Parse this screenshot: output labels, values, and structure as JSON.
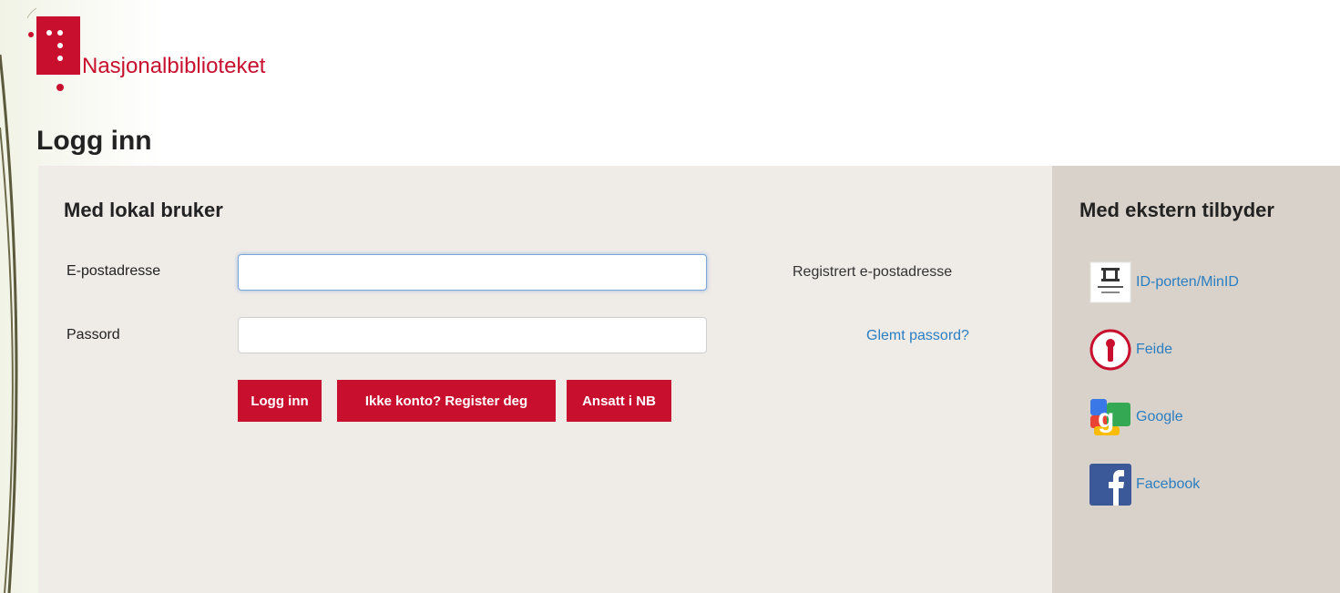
{
  "brand": {
    "name": "Nasjonalbiblioteket",
    "color": "#c8102e"
  },
  "page": {
    "title": "Logg inn"
  },
  "local": {
    "title": "Med lokal bruker",
    "email": {
      "label": "E-postadresse",
      "value": "",
      "placeholder": "",
      "hint": "Registrert e-postadresse"
    },
    "password": {
      "label": "Passord",
      "value": "",
      "placeholder": "",
      "forgot_link": "Glemt passord?"
    },
    "buttons": {
      "login": "Logg inn",
      "register": "Ikke konto? Register deg",
      "employee": "Ansatt i NB"
    }
  },
  "external": {
    "title": "Med ekstern tilbyder",
    "providers": [
      {
        "label": "ID-porten/MinID",
        "icon": "idporten-icon"
      },
      {
        "label": "Feide",
        "icon": "feide-icon"
      },
      {
        "label": "Google",
        "icon": "google-icon"
      },
      {
        "label": "Facebook",
        "icon": "facebook-icon"
      }
    ]
  },
  "colors": {
    "accent": "#c8102e",
    "link": "#2a7ec2",
    "panel": "#efebe7",
    "panel_ext": "#d9d2ca"
  }
}
